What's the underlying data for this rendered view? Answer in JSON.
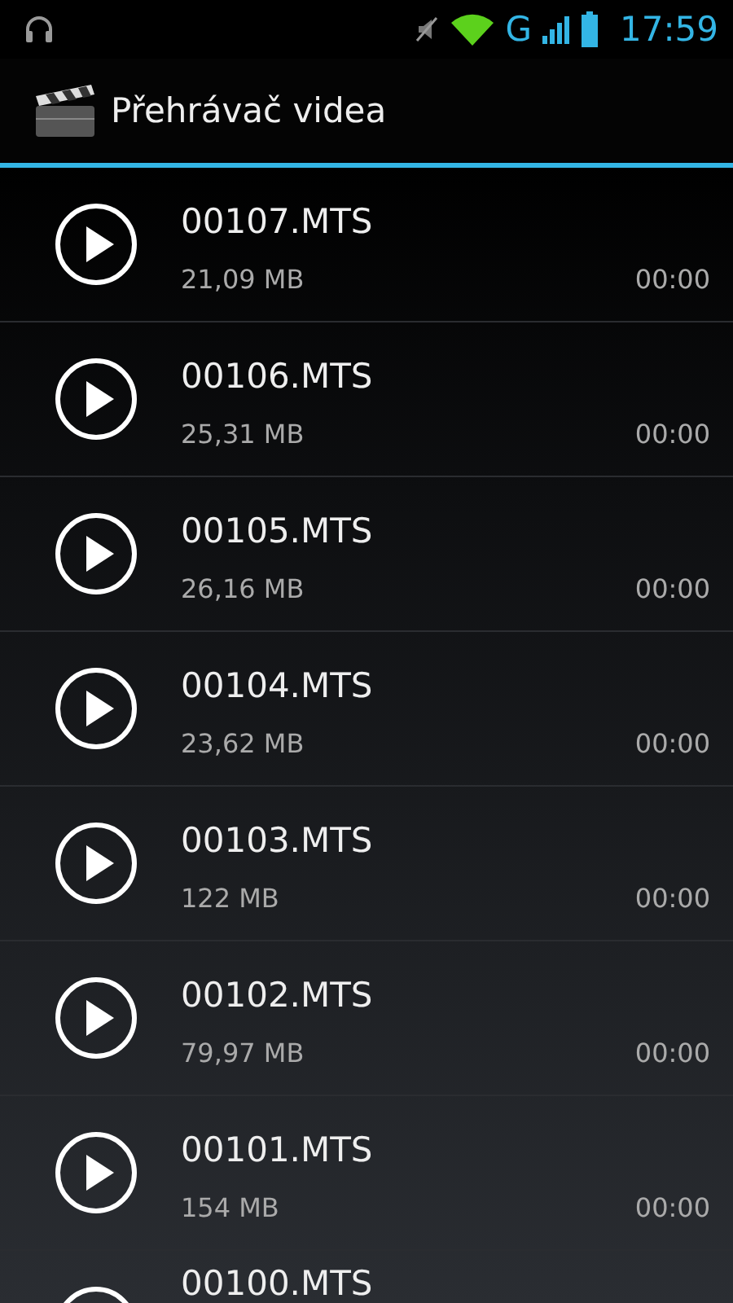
{
  "status_bar": {
    "network": "G",
    "time": "17:59"
  },
  "action_bar": {
    "title": "Přehrávač videa"
  },
  "videos": [
    {
      "name": "00107.MTS",
      "size": "21,09 MB",
      "duration": "00:00"
    },
    {
      "name": "00106.MTS",
      "size": "25,31 MB",
      "duration": "00:00"
    },
    {
      "name": "00105.MTS",
      "size": "26,16 MB",
      "duration": "00:00"
    },
    {
      "name": "00104.MTS",
      "size": "23,62 MB",
      "duration": "00:00"
    },
    {
      "name": "00103.MTS",
      "size": "122 MB",
      "duration": "00:00"
    },
    {
      "name": "00102.MTS",
      "size": "79,97 MB",
      "duration": "00:00"
    },
    {
      "name": "00101.MTS",
      "size": "154 MB",
      "duration": "00:00"
    },
    {
      "name": "00100.MTS"
    }
  ]
}
